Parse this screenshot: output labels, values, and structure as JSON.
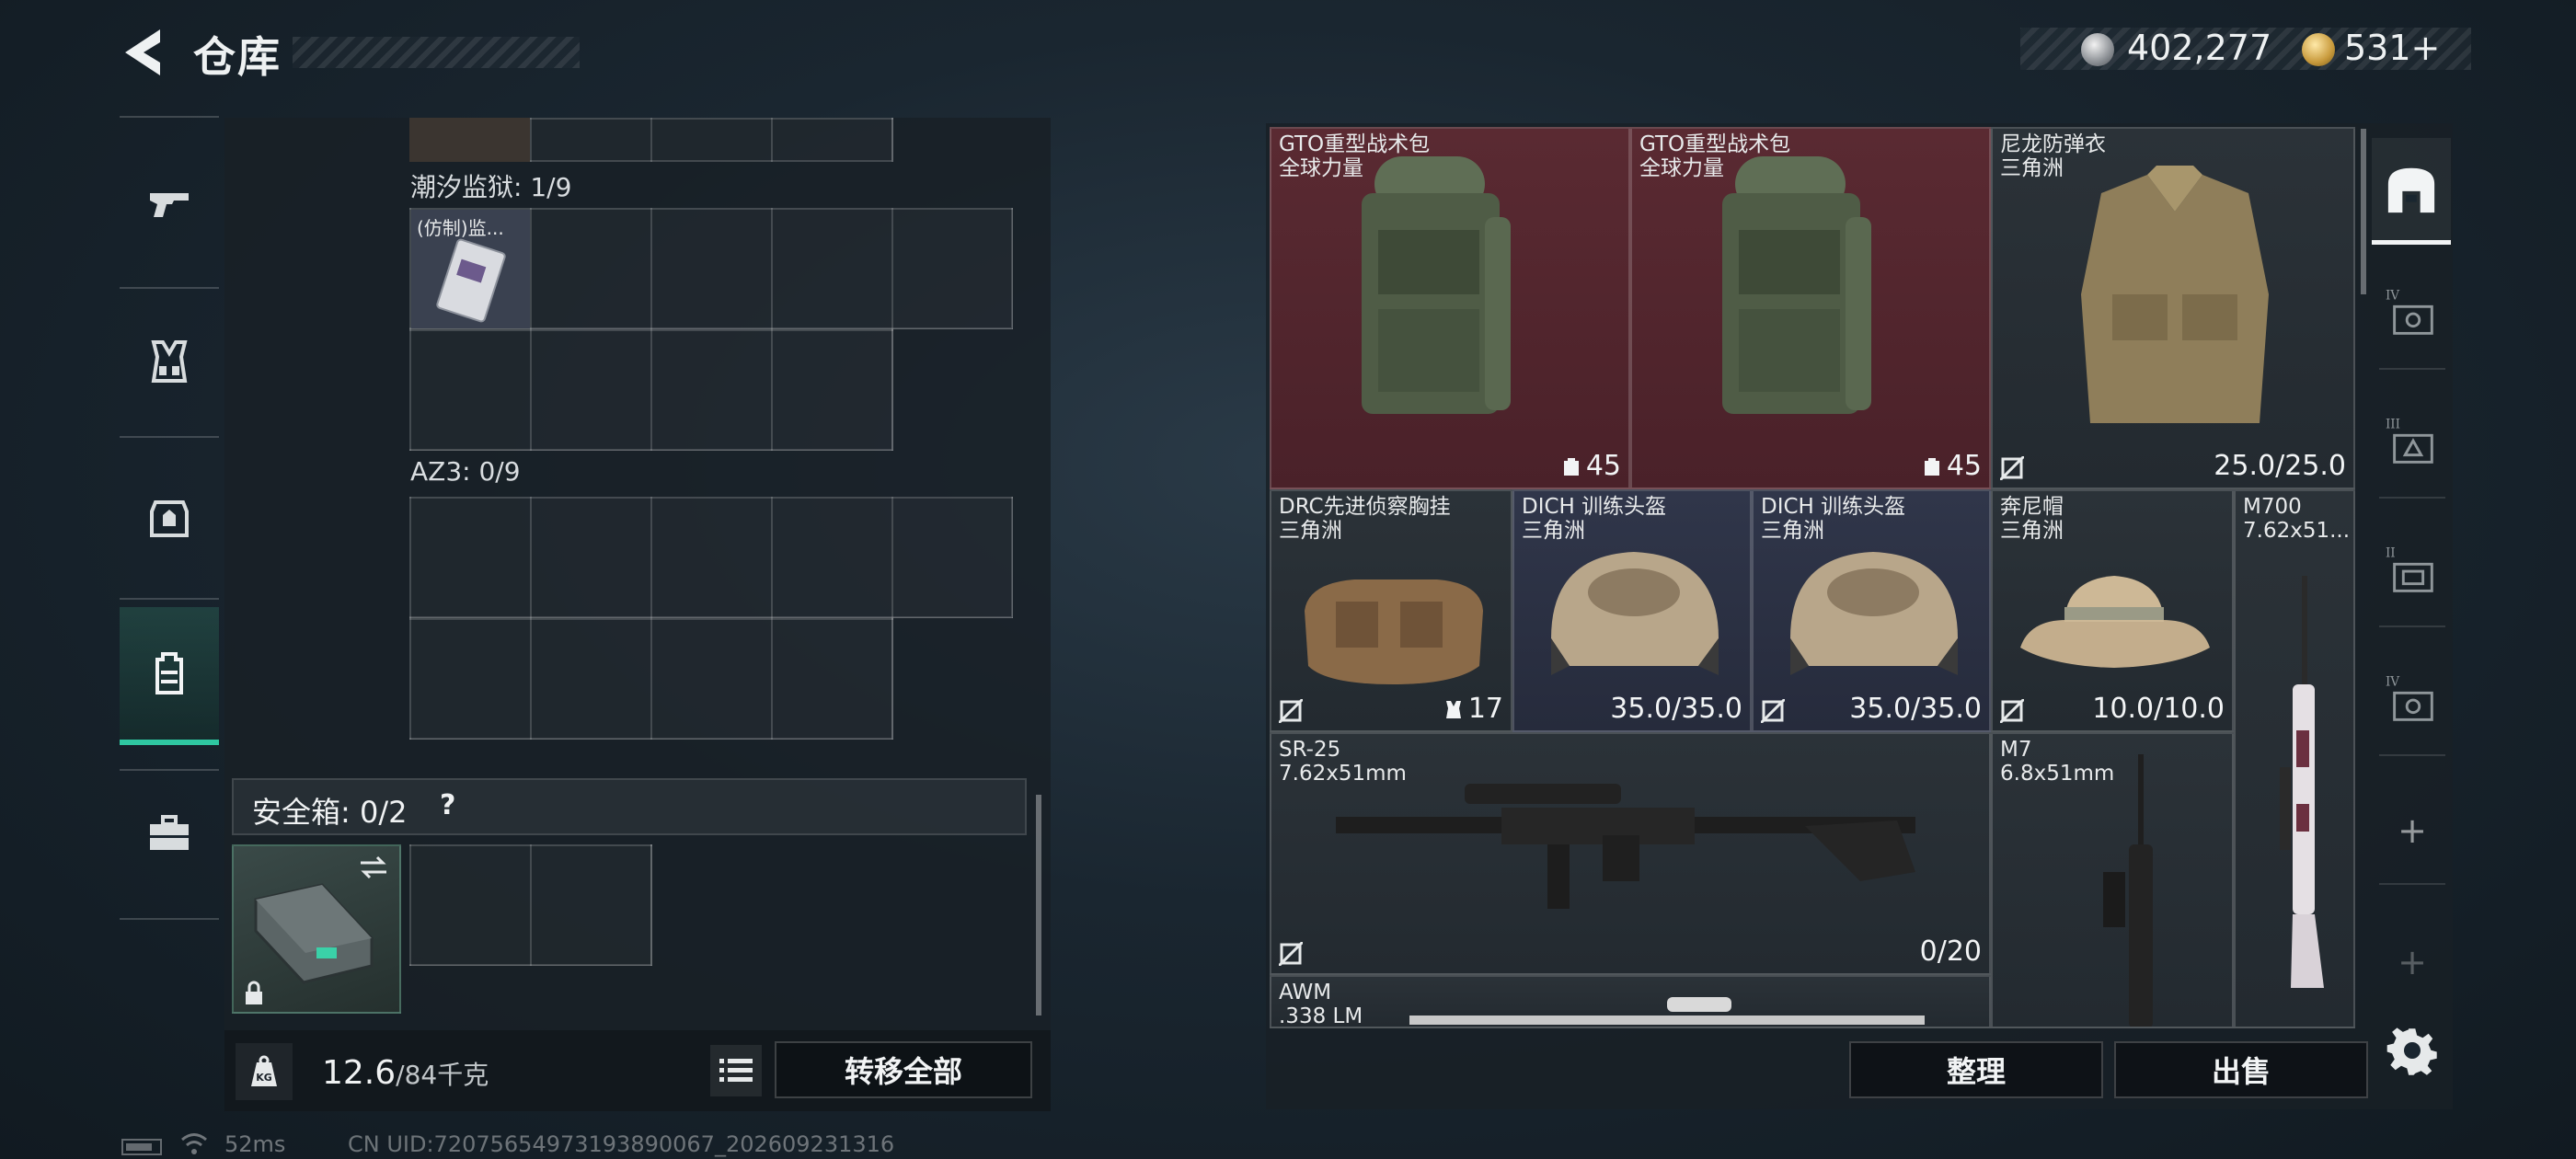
{
  "header": {
    "title": "仓库",
    "silver_amount": "402,277",
    "gold_amount": "531",
    "gold_plus": "+"
  },
  "left_rail": {
    "items": [
      {
        "name": "weapons",
        "icon": "pistol-icon"
      },
      {
        "name": "vests",
        "icon": "chest-rig-icon"
      },
      {
        "name": "armor",
        "icon": "armor-icon"
      },
      {
        "name": "backpacks",
        "icon": "backpack-icon",
        "active": true
      },
      {
        "name": "cases",
        "icon": "briefcase-icon"
      }
    ]
  },
  "left_panel": {
    "top_container_label": "潮汐监狱: 1/9",
    "top_container_item": "(仿制)监...",
    "second_container_label": "AZ3: 0/9",
    "safe_label": "安全箱: 0/2",
    "safe_help": "?",
    "weight_value": "12.6",
    "weight_max": "/84千克",
    "transfer_label": "转移全部"
  },
  "stash": {
    "items": [
      {
        "name": "GTO重型战术包",
        "sub": "全球力量",
        "value": "45",
        "bg": "red"
      },
      {
        "name": "GTO重型战术包",
        "sub": "全球力量",
        "value": "45",
        "bg": "red"
      },
      {
        "name": "尼龙防弹衣",
        "sub": "三角洲",
        "value": "25.0/25.0",
        "bg": "gray"
      },
      {
        "name": "DRC先进侦察胸挂",
        "sub": "三角洲",
        "value": "17",
        "bg": "gray"
      },
      {
        "name": "DICH 训练头盔",
        "sub": "三角洲",
        "value": "35.0/35.0",
        "bg": "blue"
      },
      {
        "name": "DICH 训练头盔",
        "sub": "三角洲",
        "value": "35.0/35.0",
        "bg": "blue"
      },
      {
        "name": "奔尼帽",
        "sub": "三角洲",
        "value": "10.0/10.0",
        "bg": "gray"
      },
      {
        "name": "M700",
        "sub": "7.62x51...",
        "value": "",
        "bg": "gray"
      },
      {
        "name": "SR-25",
        "sub": "7.62x51mm",
        "value": "0/20",
        "bg": "gray"
      },
      {
        "name": "M7",
        "sub": "6.8x51mm",
        "value": "",
        "bg": "gray"
      },
      {
        "name": "AWM",
        "sub": ".338 LM",
        "value": "",
        "bg": "gray"
      }
    ],
    "sort_label": "整理",
    "sell_label": "出售"
  },
  "page_rail": {
    "tabs": [
      "IV",
      "III",
      "II",
      "IV"
    ],
    "add_label": "+"
  },
  "status": {
    "ping": "52ms",
    "uid": "CN UID:72075654973193890067_202609231316"
  },
  "colors": {
    "accent": "#2fc7a1",
    "red_rarity": "#5a2a32",
    "blue_rarity": "#30364a",
    "gray_rarity": "#2b3238"
  }
}
